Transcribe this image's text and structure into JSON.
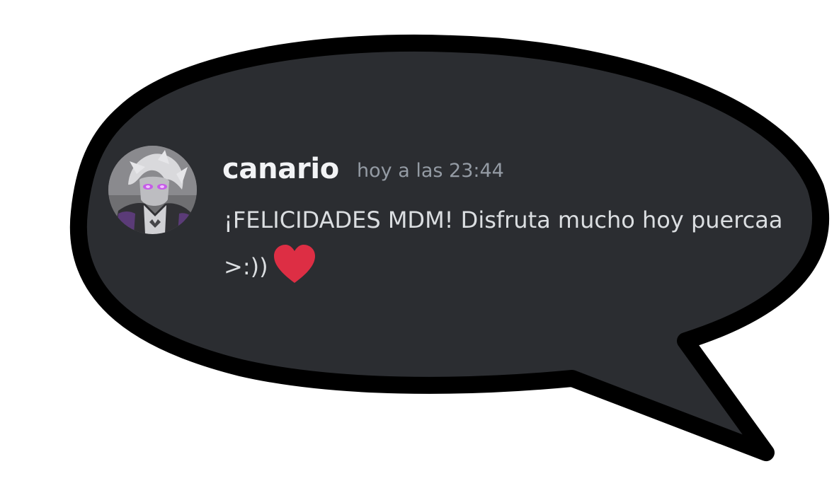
{
  "message": {
    "author": "canario",
    "timestamp": "hoy a las 23:44",
    "text": "¡FELICIDADES MDM! Disfruta mucho hoy puercaa >:))",
    "emoji": "red-heart"
  },
  "colors": {
    "bubble_fill": "#2b2d31",
    "bubble_outline": "#000000",
    "username": "#f2f3f5",
    "timestamp": "#949ba4",
    "message_text": "#dbdee1",
    "heart": "#dd2e44",
    "avatar_accent": "#b44cd6"
  }
}
